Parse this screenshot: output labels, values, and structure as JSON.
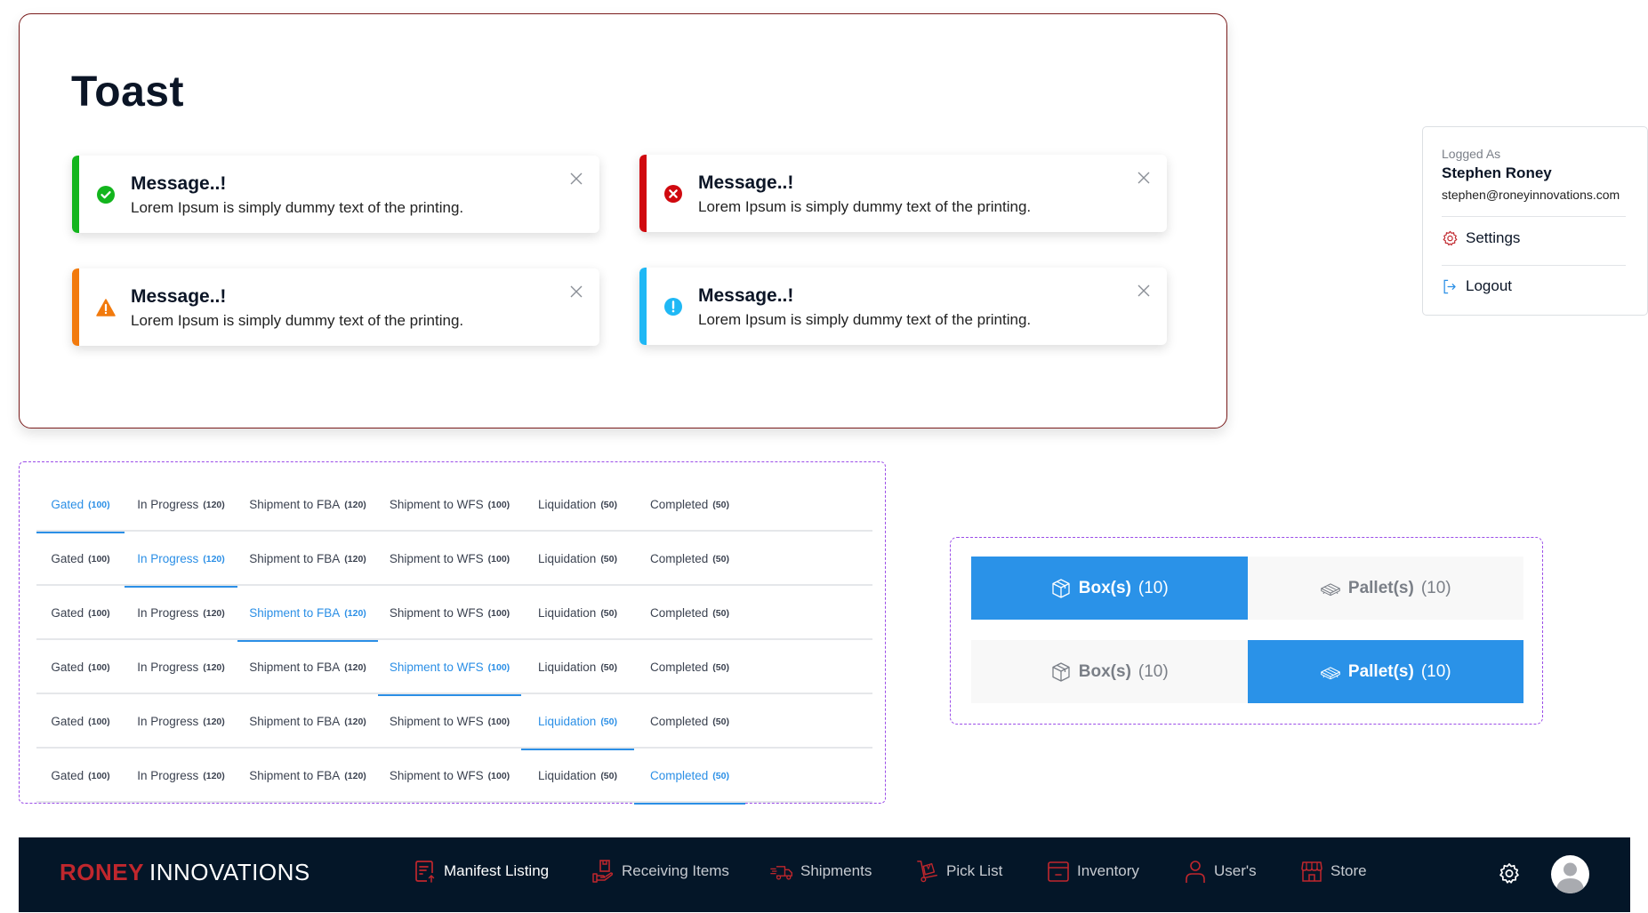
{
  "toast_section": {
    "title": "Toast",
    "toasts": [
      {
        "type": "success",
        "icon": "check-circle-icon",
        "heading": "Message..!",
        "body": "Lorem Ipsum is simply dummy text of the printing.",
        "color": "#13b51d"
      },
      {
        "type": "error",
        "icon": "x-circle-icon",
        "heading": "Message..!",
        "body": "Lorem Ipsum is simply dummy text of the printing.",
        "color": "#d0090f"
      },
      {
        "type": "warning",
        "icon": "warning-triangle-icon",
        "heading": "Message..!",
        "body": "Lorem Ipsum is simply dummy text of the printing.",
        "color": "#f27a0d"
      },
      {
        "type": "info",
        "icon": "info-circle-icon",
        "heading": "Message..!",
        "body": "Lorem Ipsum is simply dummy text of the printing.",
        "color": "#1fb8f5"
      }
    ]
  },
  "tabs": {
    "items": [
      {
        "label": "Gated",
        "count": "(100)"
      },
      {
        "label": "In Progress",
        "count": "(120)"
      },
      {
        "label": "Shipment to FBA",
        "count": "(120)"
      },
      {
        "label": "Shipment to WFS",
        "count": "(100)"
      },
      {
        "label": "Liquidation",
        "count": "(50)"
      },
      {
        "label": "Completed",
        "count": "(50)"
      }
    ],
    "variants_active_index": [
      0,
      1,
      2,
      3,
      4,
      5
    ],
    "accent_color": "#2b8fe6"
  },
  "box_pallet": {
    "box": {
      "label": "Box(s)",
      "count": "(10)",
      "icon": "box-icon"
    },
    "pallet": {
      "label": "Pallet(s)",
      "count": "(10)",
      "icon": "pallet-icon"
    },
    "variants_selected": [
      "box",
      "pallet"
    ],
    "accent_color": "#2a92e8"
  },
  "user_menu": {
    "label": "Logged As",
    "name": "Stephen Roney",
    "email": "stephen@roneyinnovations.com",
    "items": [
      {
        "label": "Settings",
        "icon": "settings-gear-icon"
      },
      {
        "label": "Logout",
        "icon": "logout-icon"
      }
    ]
  },
  "navbar": {
    "logo_brand": "RONEY",
    "logo_suffix": "INNOVATIONS",
    "items": [
      {
        "label": "Manifest Listing",
        "icon": "manifest-icon"
      },
      {
        "label": "Receiving Items",
        "icon": "receiving-icon"
      },
      {
        "label": "Shipments",
        "icon": "truck-icon"
      },
      {
        "label": "Pick List",
        "icon": "hand-truck-icon"
      },
      {
        "label": "Inventory",
        "icon": "inventory-icon"
      },
      {
        "label": "User's",
        "icon": "user-icon"
      },
      {
        "label": "Store",
        "icon": "store-icon"
      }
    ],
    "brand_color": "#c0272d",
    "background": "#041628"
  }
}
